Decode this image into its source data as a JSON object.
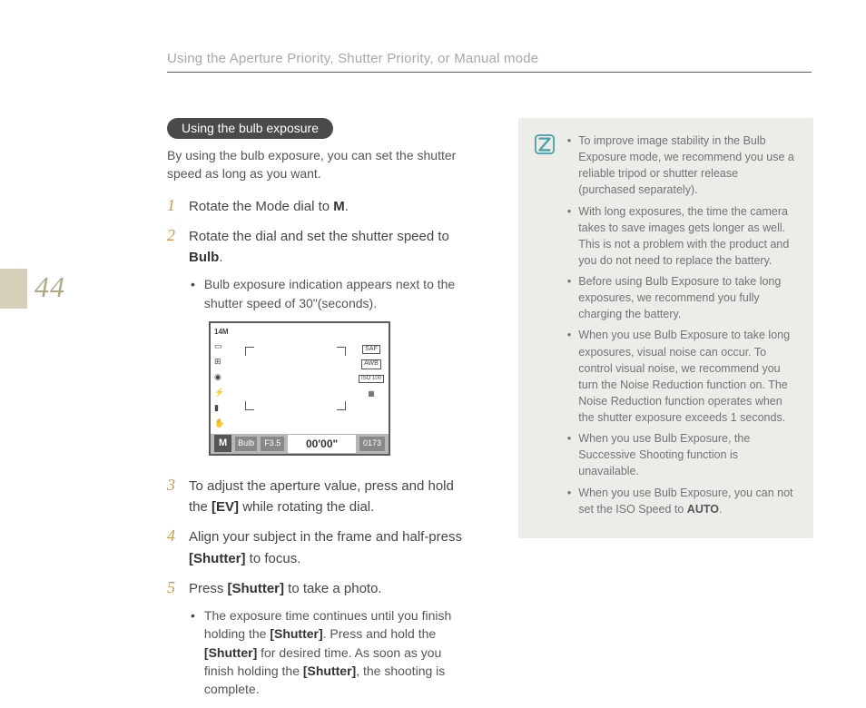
{
  "page_number": "44",
  "header": "Using the Aperture Priority, Shutter Priority, or Manual mode",
  "section": {
    "pill": "Using the bulb exposure",
    "intro": "By using the bulb exposure, you can set the shutter speed as long as you want."
  },
  "steps": {
    "s1_num": "1",
    "s1_a": "Rotate the Mode dial to ",
    "s1_b": "M",
    "s1_c": ".",
    "s2_num": "2",
    "s2_a": "Rotate the dial and set the shutter speed to ",
    "s2_b": "Bulb",
    "s2_c": ".",
    "s2_sub": "Bulb exposure indication appears next to the shutter speed of 30\"(seconds).",
    "s3_num": "3",
    "s3_a": "To adjust the aperture value, press and hold the ",
    "s3_b": "[EV]",
    "s3_c": " while rotating the dial.",
    "s4_num": "4",
    "s4_a": "Align your subject in the frame and half-press ",
    "s4_b": "[Shutter]",
    "s4_c": " to focus.",
    "s5_num": "5",
    "s5_a": "Press ",
    "s5_b": "[Shutter]",
    "s5_c": " to take a photo.",
    "s5_sub_a": "The exposure time continues until you finish holding the ",
    "s5_sub_b": "[Shutter]",
    "s5_sub_c": ". Press and hold the ",
    "s5_sub_d": "[Shutter]",
    "s5_sub_e": " for desired time. As soon as you finish holding the ",
    "s5_sub_f": "[Shutter]",
    "s5_sub_g": ", the shooting is complete."
  },
  "lcd": {
    "top_label": "14M",
    "mode": "M",
    "bulb": "Bulb",
    "f": "F3.5",
    "time": "00'00\"",
    "count": "0173",
    "saf": "SAF",
    "awb": "AWB",
    "iso": "ISO 100"
  },
  "notes": {
    "n1": "To improve image stability in the Bulb Exposure mode, we recommend you use a reliable tripod or shutter release (purchased separately).",
    "n2": "With long exposures, the time the camera takes to save images gets longer as well. This is not a problem with the product and you do not need to replace the battery.",
    "n3": "Before using Bulb Exposure to take long exposures, we recommend you fully charging the battery.",
    "n4": "When you use Bulb Exposure to take long exposures, visual noise can occur. To control visual noise, we recommend you turn the Noise Reduction function on. The Noise Reduction function operates when the shutter exposure exceeds 1 seconds.",
    "n5": "When you use Bulb Exposure, the Successive Shooting function is unavailable.",
    "n6_a": "When you use Bulb Exposure, you can not set the ISO Speed to ",
    "n6_b": "AUTO",
    "n6_c": "."
  }
}
